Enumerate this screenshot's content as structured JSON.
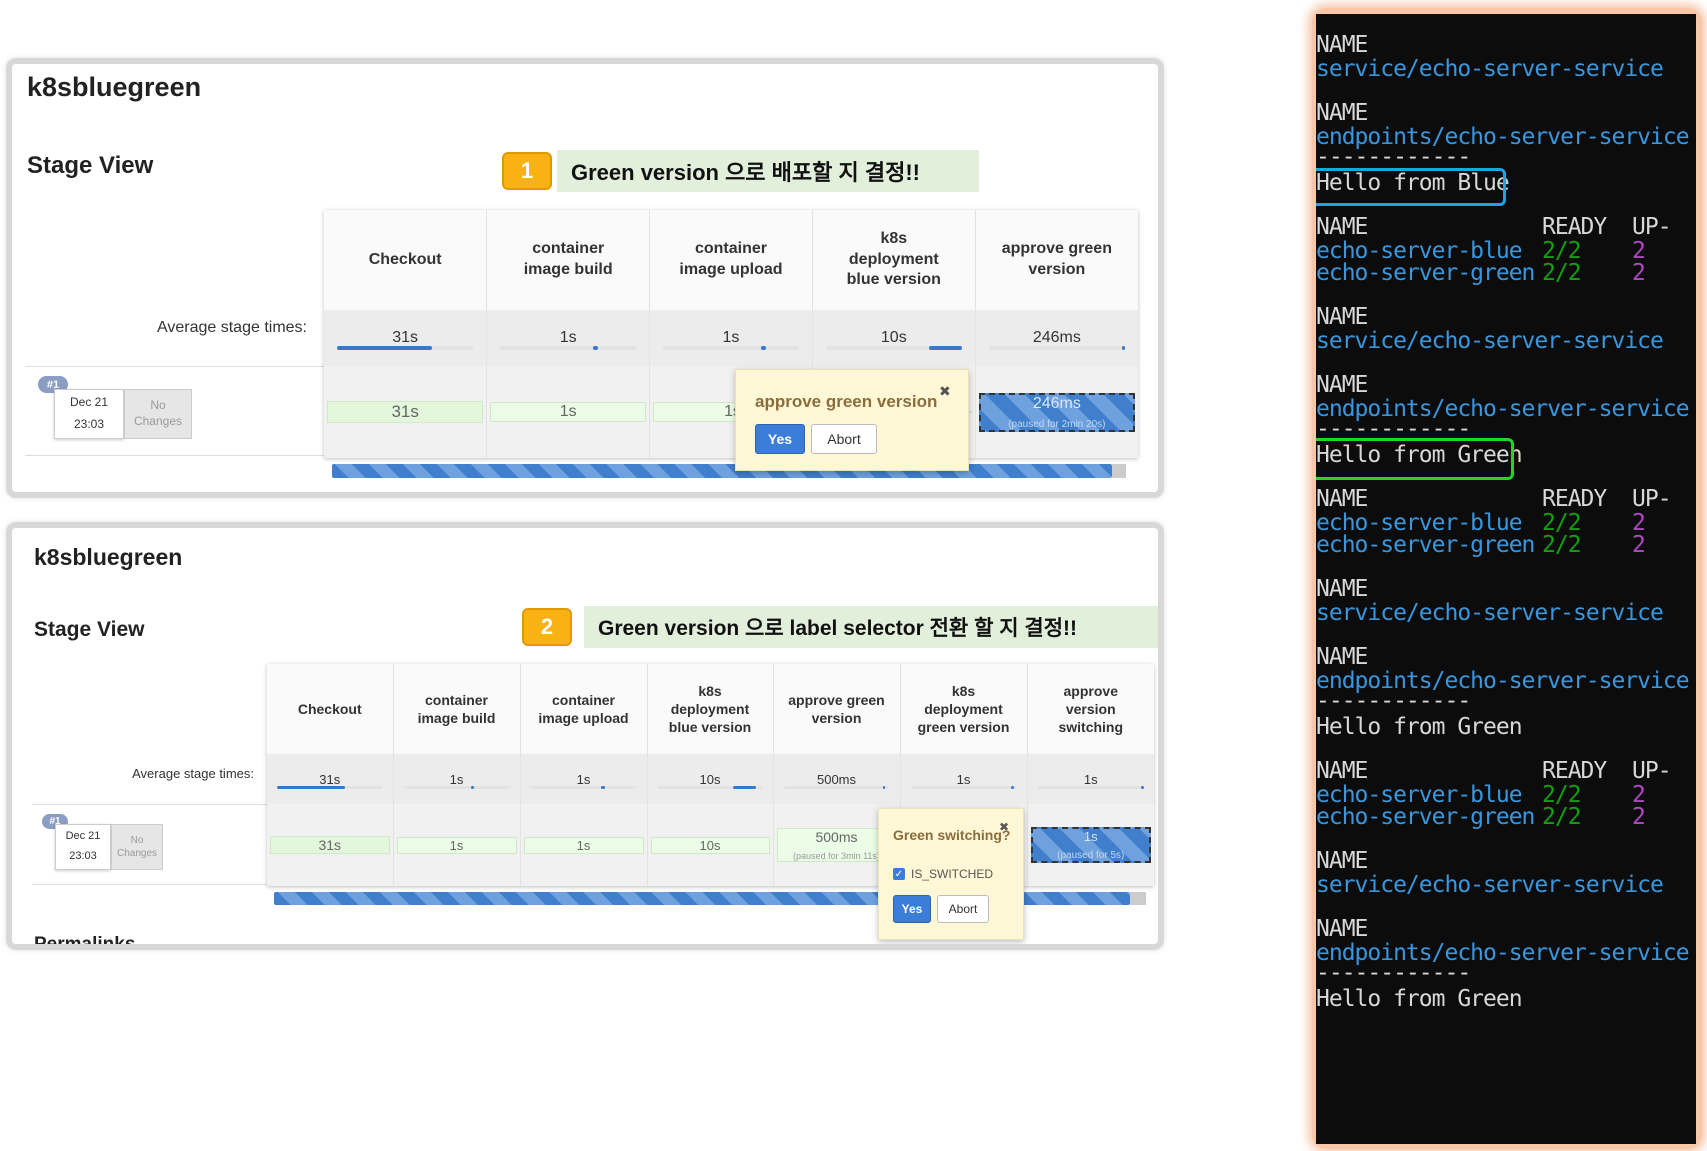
{
  "top_panel": {
    "job_title": "k8sbluegreen",
    "stage_view_label": "Stage View",
    "callout_number": "1",
    "callout_text": "Green version 으로 배포할 지 결정!!",
    "stages": [
      {
        "name": "Checkout",
        "avg": "31s",
        "run": "31s"
      },
      {
        "name": "container image build",
        "avg": "1s",
        "run": "1s"
      },
      {
        "name": "container image upload",
        "avg": "1s",
        "run": "1s"
      },
      {
        "name": "k8s deployment blue version",
        "avg": "10s",
        "run": ""
      },
      {
        "name": "approve green version",
        "avg": "246ms",
        "run": "246ms",
        "paused_note": "(paused for 2min 20s)"
      }
    ],
    "avg_label": "Average stage times:",
    "build": {
      "badge": "#1",
      "date": "Dec 21",
      "time": "23:03",
      "changes_line1": "No",
      "changes_line2": "Changes"
    },
    "popup": {
      "title": "approve green version",
      "yes": "Yes",
      "abort": "Abort",
      "close": "✖"
    }
  },
  "bottom_panel": {
    "job_title": "k8sbluegreen",
    "stage_view_label": "Stage View",
    "callout_number": "2",
    "callout_text": "Green version 으로 label selector 전환 할 지 결정!!",
    "stages": [
      {
        "name": "Checkout",
        "avg": "31s",
        "run": "31s"
      },
      {
        "name": "container image build",
        "avg": "1s",
        "run": "1s"
      },
      {
        "name": "container image upload",
        "avg": "1s",
        "run": "1s"
      },
      {
        "name": "k8s deployment blue version",
        "avg": "10s",
        "run": "10s"
      },
      {
        "name": "approve green version",
        "avg": "500ms",
        "run": "500ms",
        "paused_note": "(paused for 3min 11s)"
      },
      {
        "name": "k8s deployment green version",
        "avg": "1s",
        "run": ""
      },
      {
        "name": "approve version switching",
        "avg": "1s",
        "run": "1s",
        "paused_note": "(paused for 5s)"
      }
    ],
    "avg_label": "Average stage times:",
    "build": {
      "badge": "#1",
      "date": "Dec 21",
      "time": "23:03",
      "changes_line1": "No",
      "changes_line2": "Changes"
    },
    "popup": {
      "title": "Green switching?",
      "param": "IS_SWITCHED",
      "yes": "Yes",
      "abort": "Abort",
      "close": "✖"
    },
    "permalinks": "Permalinks"
  },
  "terminal": {
    "name": "NAME",
    "ready": "READY",
    "up": "UP-",
    "service": "service/echo-server-service",
    "endpoints": "endpoints/echo-server-service",
    "dashes": "------------",
    "blue_deploy": "echo-server-blue",
    "green_deploy": "echo-server-green",
    "ready_val": "2/2",
    "up_val": "2",
    "hello_blue": "Hello from Blue",
    "hello_green": "Hello from Green",
    "highlight_blue_color": "#1aa6e6",
    "highlight_green_color": "#1fd81f"
  }
}
